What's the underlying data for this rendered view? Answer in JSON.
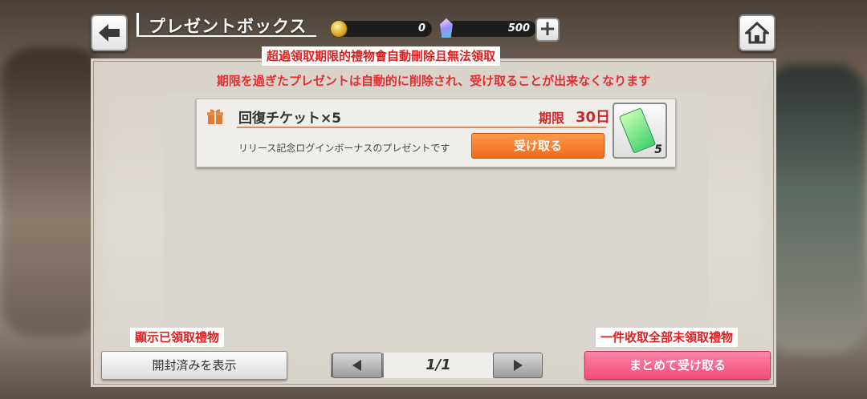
{
  "header": {
    "title": "プレゼントボックス",
    "coin_value": "0",
    "gem_value": "500",
    "plus_label": "+"
  },
  "notes": {
    "top": "超過領取期限的禮物會自動刪除且無法領取",
    "left": "顯示已領取禮物",
    "right": "一件收取全部未領取禮物"
  },
  "panel": {
    "expire_message": "期限を過ぎたプレゼントは自動的に削除され、受け取ることが出来なくなります"
  },
  "gifts": [
    {
      "name": "回復チケット×5",
      "limit_label": "期限",
      "limit_value": "30日",
      "description": "リリース記念ログインボーナスのプレゼントです",
      "receive_label": "受け取る",
      "item_count": "5"
    }
  ],
  "footer": {
    "show_opened_label": "開封済みを表示",
    "page_indicator": "1/1",
    "receive_all_label": "まとめて受け取る"
  },
  "colors": {
    "warning_red": "#e03030",
    "receive_orange": "#f06a1a",
    "receive_all_pink": "#f04c7c"
  }
}
